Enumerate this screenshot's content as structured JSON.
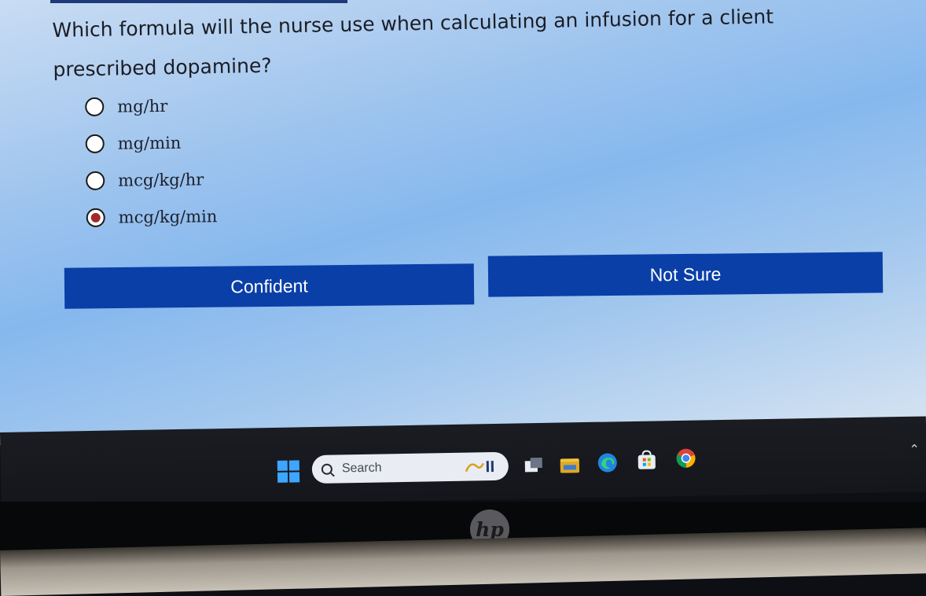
{
  "question": {
    "text": "Which formula will the nurse use when calculating an infusion for a client prescribed dopamine?"
  },
  "options": [
    {
      "label": "mg/hr",
      "selected": false
    },
    {
      "label": "mg/min",
      "selected": false
    },
    {
      "label": "mcg/kg/hr",
      "selected": false
    },
    {
      "label": "mcg/kg/min",
      "selected": true
    }
  ],
  "buttons": {
    "confident": "Confident",
    "not_sure": "Not Sure"
  },
  "taskbar": {
    "search_placeholder": "Search",
    "icons": [
      "windows-start-icon",
      "search-icon",
      "task-view-icon",
      "file-explorer-icon",
      "edge-icon",
      "microsoft-store-icon",
      "chrome-icon"
    ]
  },
  "colors": {
    "button_bg": "#0a3fa8",
    "button_text": "#ffffff",
    "selected_radio": "#a02a2a",
    "windows_blue": "#3ea6ff"
  }
}
